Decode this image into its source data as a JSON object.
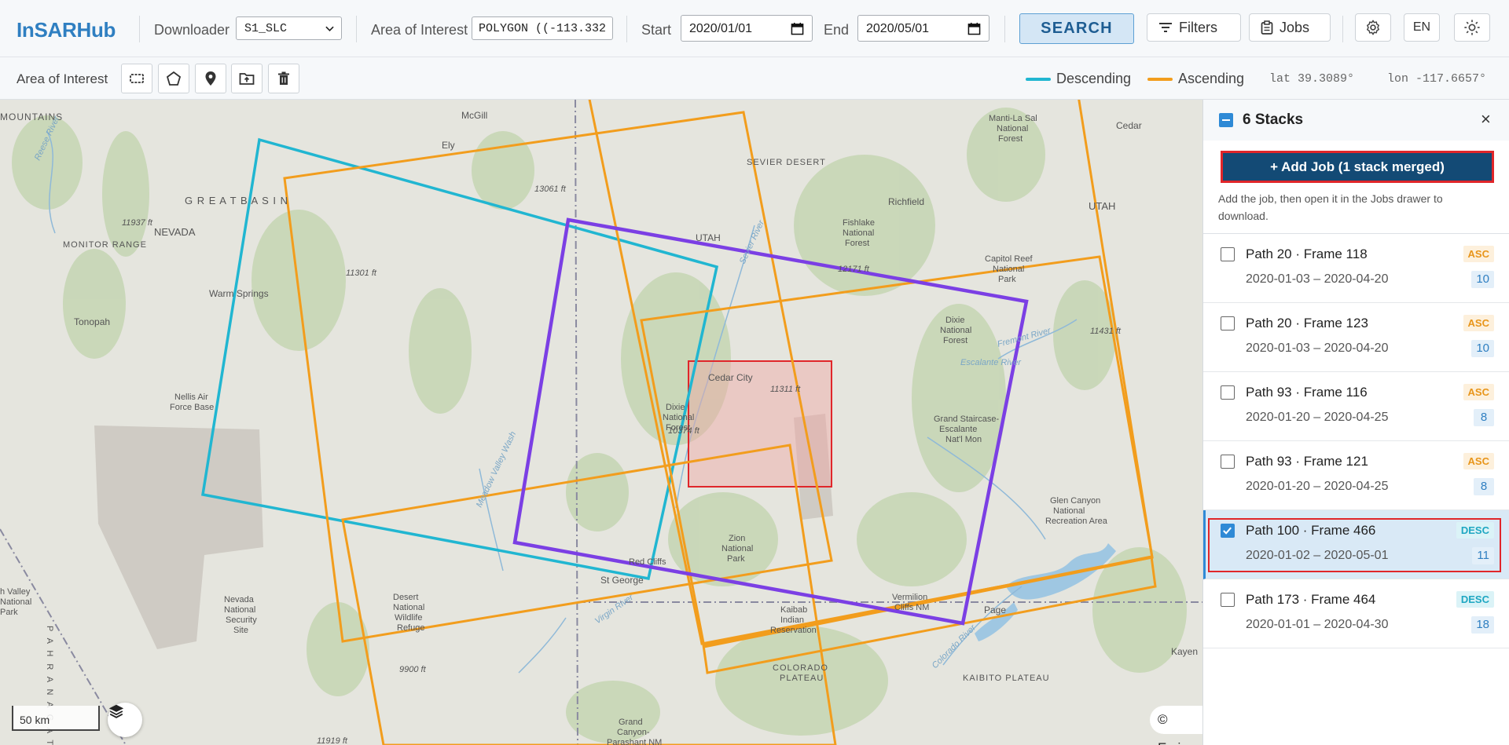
{
  "app": {
    "title": "InSARHub"
  },
  "toolbar": {
    "downloader_label": "Downloader",
    "downloader_value": "S1_SLC",
    "aoi_label": "Area of Interest",
    "aoi_value": "POLYGON ((-113.332",
    "start_label": "Start",
    "start_value": "2020/01/01",
    "end_label": "End",
    "end_value": "2020/05/01",
    "search_label": "SEARCH",
    "filters_label": "Filters",
    "jobs_label": "Jobs",
    "lang_label": "EN"
  },
  "subbar": {
    "aoi_label": "Area of Interest",
    "legend": [
      {
        "label": "Descending",
        "color": "#21b6d1"
      },
      {
        "label": "Ascending",
        "color": "#f29d1d"
      }
    ],
    "lat": "lat 39.3089°",
    "lon": "lon -117.6657°"
  },
  "map": {
    "scale_label": "50 km",
    "attribution": "© Esri,",
    "aoi_color": "#e0262a",
    "selected_color": "#7b3fe4",
    "places": [
      "MOUNTAINS",
      "McGill",
      "Ely",
      "SEVIER DESERT",
      "Manti-La Sal",
      "National",
      "Forest",
      "Cedar",
      "G R E A T   B A S I N",
      "13061 ft",
      "UTAH",
      "UTAH",
      "NEVADA",
      "11937 ft",
      "Fishlake",
      "National",
      "Forest",
      "Richfield",
      "MONITOR RANGE",
      "11301 ft",
      "12171 ft",
      "Capitol Reef",
      "National",
      "Park",
      "Warm Springs",
      "Tonopah",
      "Dixie",
      "National",
      "Forest",
      "11431 ft",
      "Escalante River",
      "Cedar City",
      "11311 ft",
      "Nellis Air",
      "Force Base",
      "Dixie",
      "National",
      "Forest",
      "Grand Staircase-",
      "Escalante",
      "Nat'l Mon",
      "Glen Canyon",
      "National",
      "Recreation Area",
      "10374 ft",
      "Zion",
      "National",
      "Park",
      "Red Cliffs",
      "St George",
      "Virgin River",
      "Kaibab",
      "Indian",
      "Reservation",
      "Vermilion",
      "Cliffs NM",
      "Page",
      "KAIBITO PLATEAU",
      "Kayen",
      "Nevada",
      "National",
      "Security",
      "Site",
      "Desert",
      "National",
      "Wildlife",
      "Refuge",
      "9900 ft",
      "COLORADO",
      "PLATEAU",
      "Grand",
      "Canyon-",
      "Parashant NM",
      "11919 ft",
      "h Valley",
      "National",
      "Park",
      "Meadow Valley Wash",
      "Reese River",
      "Sevier River",
      "Fremont River",
      "Colorado River",
      "P A H R A N A G A T"
    ]
  },
  "panel": {
    "title": "6 Stacks",
    "close": "×",
    "add_job": "+ Add Job (1 stack merged)",
    "note": "Add the job, then open it in the Jobs drawer to download.",
    "stacks": [
      {
        "title": "Path 20 · Frame 118",
        "range": "2020-01-03 – 2020-04-20",
        "dir": "ASC",
        "count": "10",
        "checked": false
      },
      {
        "title": "Path 20 · Frame 123",
        "range": "2020-01-03 – 2020-04-20",
        "dir": "ASC",
        "count": "10",
        "checked": false
      },
      {
        "title": "Path 93 · Frame 116",
        "range": "2020-01-20 – 2020-04-25",
        "dir": "ASC",
        "count": "8",
        "checked": false
      },
      {
        "title": "Path 93 · Frame 121",
        "range": "2020-01-20 – 2020-04-25",
        "dir": "ASC",
        "count": "8",
        "checked": false
      },
      {
        "title": "Path 100 · Frame 466",
        "range": "2020-01-02 – 2020-05-01",
        "dir": "DESC",
        "count": "11",
        "checked": true
      },
      {
        "title": "Path 173 · Frame 464",
        "range": "2020-01-01 – 2020-04-30",
        "dir": "DESC",
        "count": "18",
        "checked": false
      }
    ]
  }
}
